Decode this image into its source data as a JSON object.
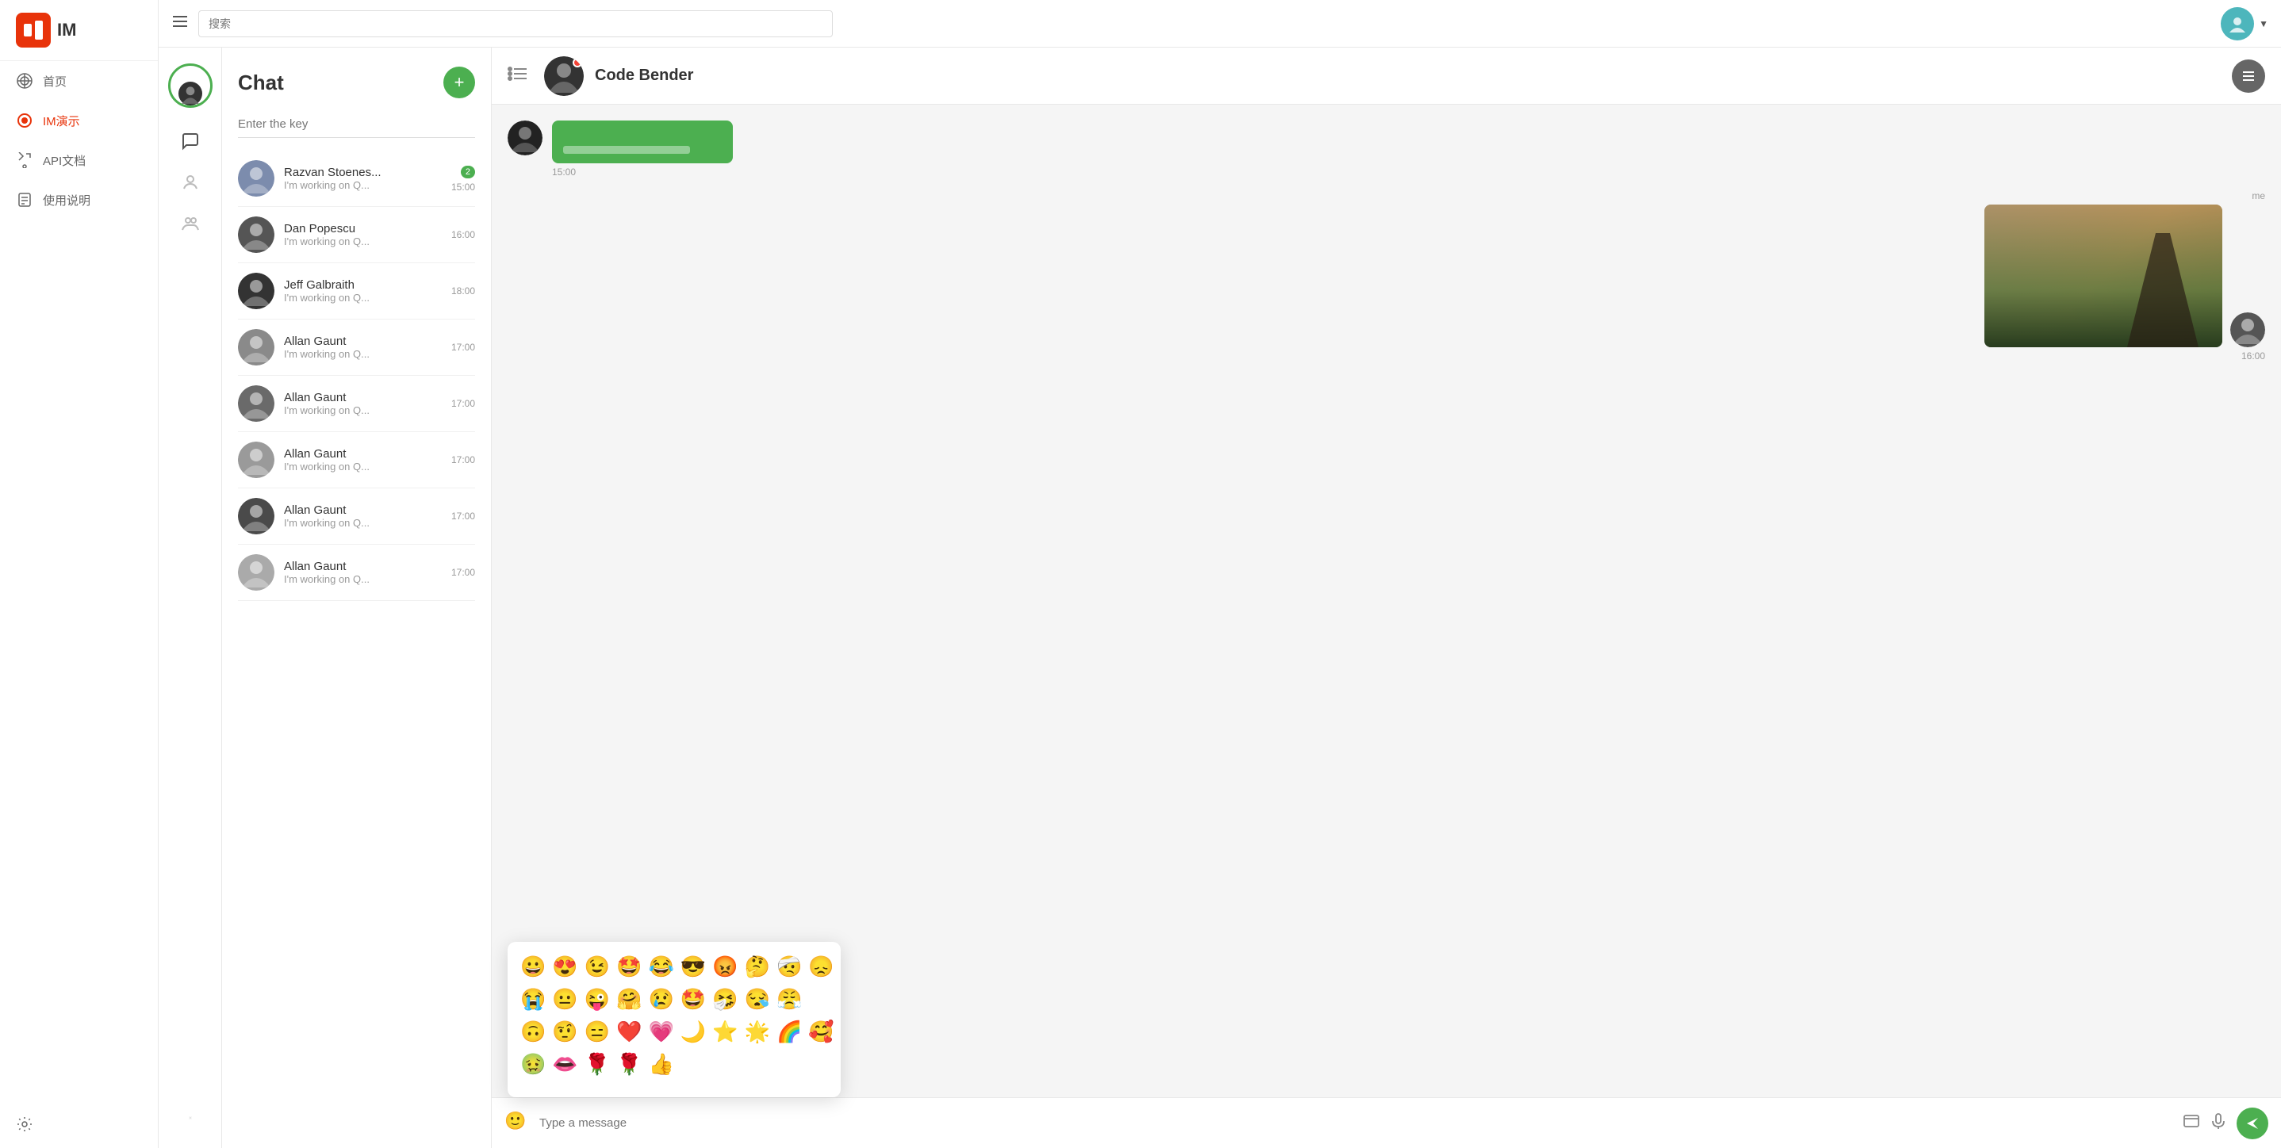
{
  "app": {
    "logo_text": "IM",
    "search_placeholder": "搜索"
  },
  "sidebar": {
    "items": [
      {
        "label": "首页",
        "icon": "home-icon",
        "active": false
      },
      {
        "label": "IM演示",
        "icon": "im-icon",
        "active": true
      },
      {
        "label": "API文档",
        "icon": "api-icon",
        "active": false
      },
      {
        "label": "使用说明",
        "icon": "guide-icon",
        "active": false
      }
    ],
    "settings_label": "设置"
  },
  "icon_panel": {
    "chat_icon": "chat-icon",
    "contact_icon": "contact-icon",
    "group_icon": "group-icon",
    "settings_icon": "settings-icon"
  },
  "chat_panel": {
    "title": "Chat",
    "add_btn": "+",
    "search_placeholder": "Enter the key",
    "conversations": [
      {
        "name": "Razvan Stoenes...",
        "msg": "I'm working on Q...",
        "time": "15:00",
        "badge": "2"
      },
      {
        "name": "Dan Popescu",
        "msg": "I'm working on Q...",
        "time": "16:00",
        "badge": ""
      },
      {
        "name": "Jeff Galbraith",
        "msg": "I'm working on Q...",
        "time": "18:00",
        "badge": ""
      },
      {
        "name": "Allan Gaunt",
        "msg": "I'm working on Q...",
        "time": "17:00",
        "badge": ""
      },
      {
        "name": "Allan Gaunt",
        "msg": "I'm working on Q...",
        "time": "17:00",
        "badge": ""
      },
      {
        "name": "Allan Gaunt",
        "msg": "I'm working on Q...",
        "time": "17:00",
        "badge": ""
      },
      {
        "name": "Allan Gaunt",
        "msg": "I'm working on Q...",
        "time": "17:00",
        "badge": ""
      },
      {
        "name": "Allan Gaunt",
        "msg": "I'm working on Q...",
        "time": "17:00",
        "badge": ""
      }
    ]
  },
  "chat_window": {
    "contact_name": "Code Bender",
    "msg_time_1": "15:00",
    "msg_time_2": "16:00",
    "me_label": "me",
    "placeholder": "Type a message",
    "online": true
  },
  "emojis": {
    "row1": [
      "😀",
      "😍",
      "😉",
      "🤩",
      "😂",
      "😎",
      "😡",
      "🤔",
      "🤕",
      "😞"
    ],
    "row2": [
      "😭",
      "😐",
      "😜",
      "🤗",
      "😢",
      "🤩",
      "🤧",
      "😪",
      "😤"
    ],
    "row3": [
      "🙃",
      "🤨",
      "😑",
      "❤️",
      "💗",
      "🌙",
      "⭐",
      "🌟",
      "🌈",
      "🥰"
    ],
    "row4": [
      "🤢",
      "👄",
      "🌹",
      "🌹",
      "👍"
    ]
  }
}
